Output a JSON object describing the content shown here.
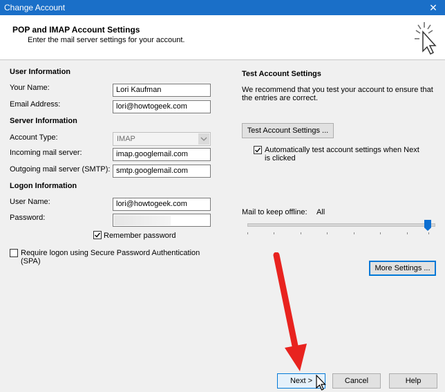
{
  "window": {
    "title": "Change Account",
    "close_glyph": "✕"
  },
  "header": {
    "title": "POP and IMAP Account Settings",
    "subtitle": "Enter the mail server settings for your account."
  },
  "user_info": {
    "heading": "User Information",
    "your_name_label": "Your Name:",
    "your_name_value": "Lori Kaufman",
    "email_label": "Email Address:",
    "email_value": "lori@howtogeek.com"
  },
  "server_info": {
    "heading": "Server Information",
    "account_type_label": "Account Type:",
    "account_type_value": "IMAP",
    "incoming_label": "Incoming mail server:",
    "incoming_value": "imap.googlemail.com",
    "outgoing_label": "Outgoing mail server (SMTP):",
    "outgoing_value": "smtp.googlemail.com"
  },
  "logon_info": {
    "heading": "Logon Information",
    "user_name_label": "User Name:",
    "user_name_value": "lori@howtogeek.com",
    "password_label": "Password:",
    "remember_label": "Remember password",
    "remember_checked": true,
    "spa_label_line1": "Require logon using Secure Password Authentication",
    "spa_label_line2": "(SPA)",
    "spa_checked": false
  },
  "test_settings": {
    "heading": "Test Account Settings",
    "description_line1": "We recommend that you test your account to ensure that",
    "description_line2": "the entries are correct.",
    "test_button": "Test Account Settings ...",
    "auto_test_line1": "Automatically test account settings when Next",
    "auto_test_line2": "is clicked",
    "auto_test_checked": true
  },
  "offline": {
    "label": "Mail to keep offline:",
    "value": "All",
    "level": 1.0
  },
  "more_settings_button": "More Settings ...",
  "footer": {
    "next_button": "Next >",
    "cancel_button": "Cancel",
    "help_button": "Help"
  },
  "colors": {
    "titlebar": "#1a6fc8",
    "arrow": "#e8231f",
    "slider": "#0d6fd1"
  },
  "icons": [
    "close-icon",
    "cursor-click-icon",
    "dropdown-arrow-icon",
    "checkmark-icon",
    "red-arrow-annotation-icon",
    "mouse-pointer-icon"
  ]
}
